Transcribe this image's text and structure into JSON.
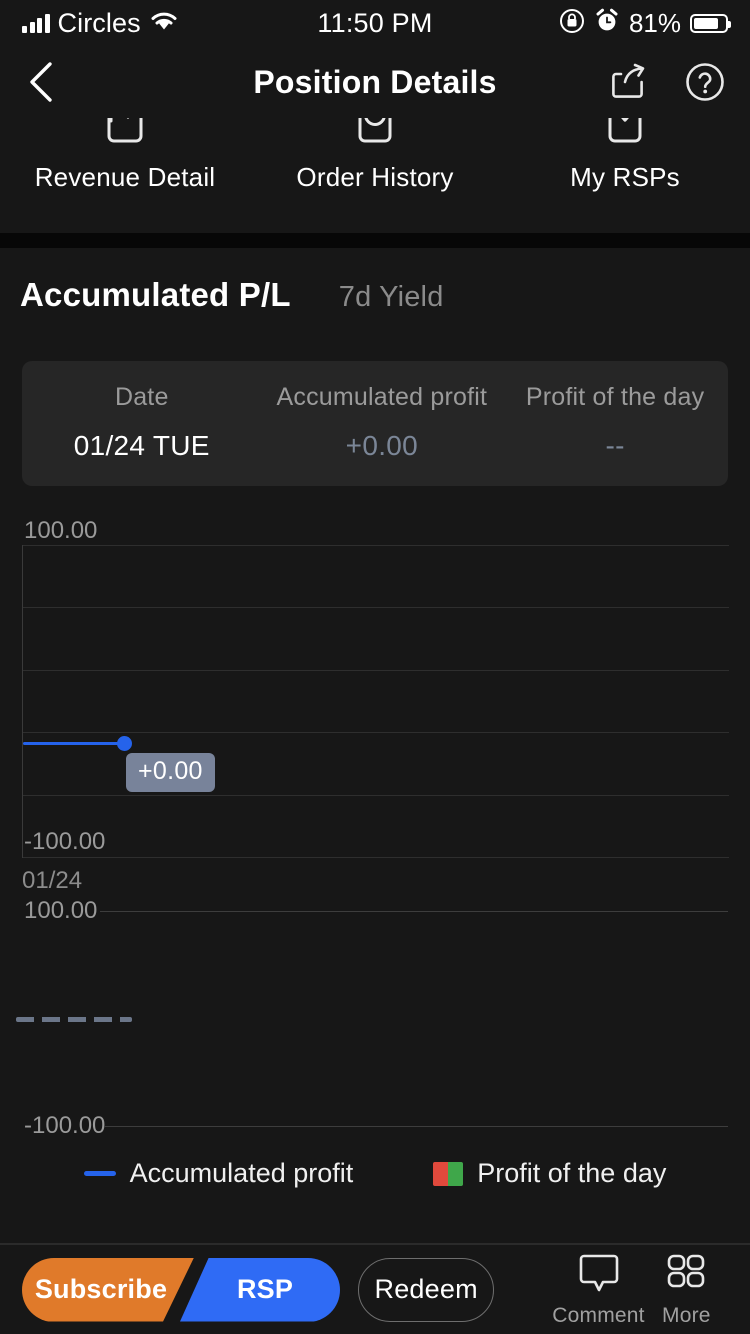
{
  "status_bar": {
    "carrier": "Circles",
    "time": "11:50 PM",
    "battery_percent": "81%",
    "icons": [
      "signal-bars-icon",
      "wifi-icon",
      "rotation-lock-icon",
      "alarm-icon",
      "battery-icon"
    ]
  },
  "nav": {
    "title": "Position Details",
    "back_icon": "back-chevron-icon",
    "share_icon": "share-icon",
    "help_icon": "help-circle-icon"
  },
  "quick_actions": [
    {
      "label": "Revenue Detail",
      "icon": "revenue-detail-icon"
    },
    {
      "label": "Order History",
      "icon": "order-history-clock-icon"
    },
    {
      "label": "My RSPs",
      "icon": "my-rsps-check-icon"
    }
  ],
  "tabs": [
    {
      "label": "Accumulated P/L",
      "active": true
    },
    {
      "label": "7d Yield",
      "active": false
    }
  ],
  "detail_card": {
    "headers": [
      "Date",
      "Accumulated profit",
      "Profit of the day"
    ],
    "values": [
      "01/24 TUE",
      "+0.00",
      "--"
    ]
  },
  "legend": [
    {
      "label": "Accumulated profit",
      "marker": "blue-line",
      "color": "#2563eb"
    },
    {
      "label": "Profit of the day",
      "marker": "red-green-square",
      "colors": [
        "#e0493c",
        "#3fa74a"
      ]
    }
  ],
  "bottom_bar": {
    "subscribe_label": "Subscribe",
    "rsp_label": "RSP",
    "redeem_label": "Redeem",
    "comment_label": "Comment",
    "comment_icon": "speech-bubble-icon",
    "more_label": "More",
    "more_icon": "grid-four-icon",
    "subscribe_color": "#e07a2a",
    "rsp_color": "#2f6bf5"
  },
  "chart_data": [
    {
      "type": "line",
      "title": "Accumulated P/L",
      "x": [
        "01/24"
      ],
      "series": [
        {
          "name": "Accumulated profit",
          "values": [
            0.0
          ],
          "color": "#2563eb"
        }
      ],
      "point_label": "+0.00",
      "y_top_label": "100.00",
      "y_bottom_label": "-100.00",
      "ylim": [
        -100,
        100
      ],
      "yticks": [
        100,
        60,
        20,
        -20,
        -60,
        -100
      ],
      "xlabel": "",
      "ylabel": "",
      "grid": true,
      "legend_position": "bottom"
    },
    {
      "type": "bar",
      "title": "Profit of the day",
      "categories": [
        "01/24"
      ],
      "values": [
        0.0
      ],
      "y_top_label": "100.00",
      "y_bottom_label": "-100.00",
      "ylim": [
        -100,
        100
      ],
      "grid": true,
      "zero_line_style": "dashed",
      "zero_line_color": "#6b7689",
      "legend_position": "bottom"
    }
  ]
}
